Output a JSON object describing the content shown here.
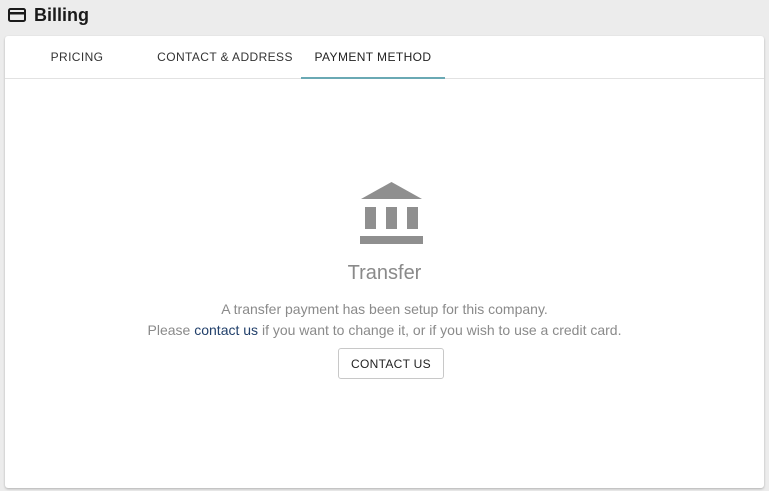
{
  "page": {
    "title": "Billing",
    "icon": "credit-card-icon"
  },
  "tabs": [
    {
      "label": "PRICING",
      "active": false
    },
    {
      "label": "CONTACT & ADDRESS",
      "active": false
    },
    {
      "label": "PAYMENT METHOD",
      "active": true
    }
  ],
  "payment": {
    "icon": "bank-icon",
    "method": "Transfer",
    "line1": "A transfer payment has been setup for this company.",
    "line2_prefix": "Please ",
    "link_text": "contact us",
    "line2_suffix": " if you want to change it, or if you wish to use a credit card.",
    "button_label": "CONTACT US"
  },
  "colors": {
    "tab_indicator": "#6aa9b4",
    "link": "#22406b",
    "muted_text": "#8a8a8a",
    "icon": "#8f8f8f"
  }
}
